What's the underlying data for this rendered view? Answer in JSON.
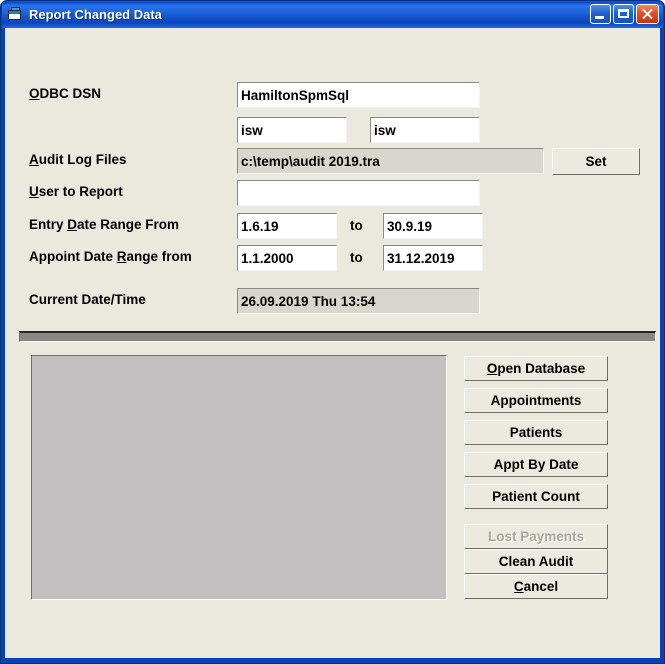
{
  "window": {
    "title": "Report Changed Data",
    "icon": "form-window-icon",
    "controls": {
      "minimize": "Minimize",
      "maximize": "Maximize",
      "close": "Close"
    },
    "colors": {
      "titlebar_blue": "#1358d8",
      "frame_blue": "#0a42b4",
      "client_bg": "#ebe8dd",
      "listbox_bg": "#c2c0c0",
      "readonly_field_bg": "#d9d6cd",
      "disabled_text": "#a9a69c"
    }
  },
  "form": {
    "labels": {
      "odbc_dsn": "ODBC DSN",
      "odbc_dsn_accel": "O",
      "audit_log_files": "Audit Log Files",
      "audit_log_files_accel": "A",
      "user_to_report": "User to Report",
      "user_to_report_accel": "U",
      "entry_date_range_from": "Entry Date Range From",
      "entry_date_range_from_accel": "D",
      "appoint_date_range_from": "Appoint Date Range from",
      "appoint_date_range_from_accel": "R",
      "current_date_time": "Current Date/Time",
      "to_1": "to",
      "to_2": "to"
    },
    "fields": {
      "odbc_dsn": {
        "value": "HamiltonSpmSql",
        "placeholder": "",
        "readonly": false
      },
      "db_user": {
        "value": "isw",
        "placeholder": "",
        "readonly": false
      },
      "db_password": {
        "value": "isw",
        "placeholder": "",
        "readonly": false
      },
      "audit_log_files": {
        "value": "c:\\temp\\audit 2019.tra",
        "placeholder": "",
        "readonly": true
      },
      "user_to_report": {
        "value": "",
        "placeholder": "",
        "readonly": false
      },
      "entry_date_from": {
        "value": "1.6.19",
        "placeholder": "",
        "readonly": false
      },
      "entry_date_to": {
        "value": "30.9.19",
        "placeholder": "",
        "readonly": false
      },
      "appoint_date_from": {
        "value": "1.1.2000",
        "placeholder": "",
        "readonly": false
      },
      "appoint_date_to": {
        "value": "31.12.2019",
        "placeholder": "",
        "readonly": false
      },
      "current_date_time": {
        "value": "26.09.2019 Thu 13:54",
        "placeholder": "",
        "readonly": true
      }
    },
    "set_button": {
      "label": "Set",
      "enabled": true
    }
  },
  "results": {
    "listbox_items": []
  },
  "actions": {
    "open_database": {
      "label": "Open Database",
      "accel": "O",
      "enabled": true
    },
    "appointments": {
      "label": "Appointments",
      "accel": "",
      "enabled": true
    },
    "patients": {
      "label": "Patients",
      "accel": "",
      "enabled": true
    },
    "appt_by_date": {
      "label": "Appt By Date",
      "accel": "",
      "enabled": true
    },
    "patient_count": {
      "label": "Patient Count",
      "accel": "",
      "enabled": true
    },
    "lost_payments": {
      "label": "Lost Payments",
      "accel": "",
      "enabled": false
    },
    "clean_audit": {
      "label": "Clean Audit",
      "accel": "",
      "enabled": true
    },
    "cancel": {
      "label": "Cancel",
      "accel": "C",
      "enabled": true
    }
  }
}
